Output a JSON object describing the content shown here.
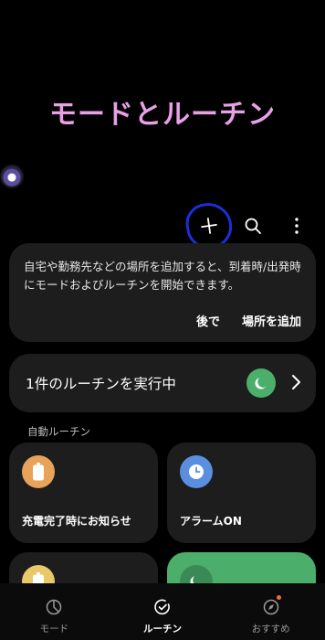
{
  "header": {
    "title": "モードとルーチン"
  },
  "toolbar": {
    "add_icon": "plus-icon",
    "search_icon": "search-icon",
    "more_icon": "more-vert-icon"
  },
  "info_card": {
    "text": "自宅や勤務先などの場所を追加すると、到着時/出発時にモードおよびルーチンを開始できます。",
    "later_label": "後で",
    "add_place_label": "場所を追加"
  },
  "running": {
    "label": "1件のルーチンを実行中",
    "icon": "moon-icon"
  },
  "section": {
    "auto_routines": "自動ルーチン"
  },
  "routines": [
    {
      "label": "充電完了時にお知らせ",
      "icon": "battery-icon",
      "color": "#e8a35a"
    },
    {
      "label": "アラームON",
      "icon": "clock-icon",
      "color": "#5a8fe0"
    },
    {
      "label": "",
      "icon": "battery-icon",
      "color": "#e8c96a"
    },
    {
      "label": "",
      "icon": "moon-icon",
      "color": "#3a8a55"
    }
  ],
  "nav": {
    "items": [
      {
        "label": "モード",
        "icon": "modes-icon",
        "active": false
      },
      {
        "label": "ルーチン",
        "icon": "routines-icon",
        "active": true
      },
      {
        "label": "おすすめ",
        "icon": "discover-icon",
        "active": false
      }
    ]
  },
  "colors": {
    "title": "#e8a0e6",
    "accent_green": "#4cae6b",
    "notification_dot": "#f26a3d",
    "annotation_circle": "#1b2fd6"
  }
}
